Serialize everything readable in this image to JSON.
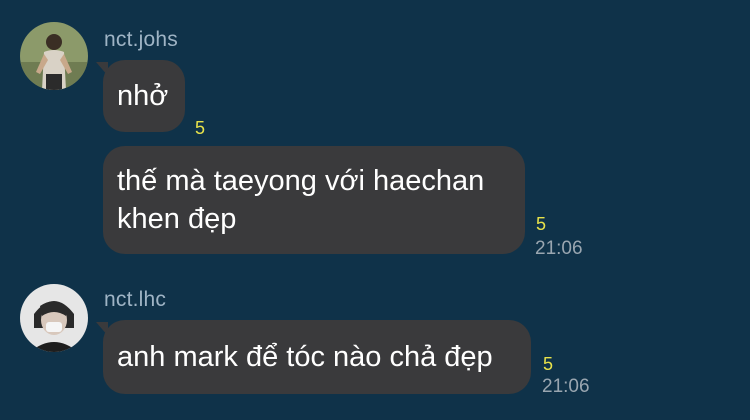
{
  "chat": {
    "groups": [
      {
        "sender": "nct.johs",
        "messages": [
          {
            "text": "nhở",
            "count": "5",
            "time": ""
          },
          {
            "line1": "thế mà taeyong với haechan",
            "line2": "khen đẹp",
            "count": "5",
            "time": "21:06"
          }
        ]
      },
      {
        "sender": "nct.lhc",
        "messages": [
          {
            "text": "anh mark để tóc nào chả đẹp",
            "count": "5",
            "time": "21:06"
          }
        ]
      }
    ]
  },
  "colors": {
    "background": "#0f3249",
    "bubble": "#3a3a3c",
    "count": "#e8e24a",
    "timestamp": "#9aa6b0",
    "sender_name": "#9fb4c5"
  }
}
